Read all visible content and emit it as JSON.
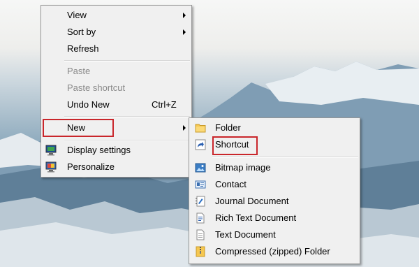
{
  "context_menu": {
    "items": [
      {
        "label": "View",
        "submenu": true
      },
      {
        "label": "Sort by",
        "submenu": true
      },
      {
        "label": "Refresh"
      },
      {
        "label": "Paste",
        "disabled": true
      },
      {
        "label": "Paste shortcut",
        "disabled": true
      },
      {
        "label": "Undo New",
        "shortcut": "Ctrl+Z"
      },
      {
        "label": "New",
        "submenu": true,
        "highlighted": true
      },
      {
        "label": "Display settings",
        "icon": "display-settings-icon"
      },
      {
        "label": "Personalize",
        "icon": "personalize-icon"
      }
    ]
  },
  "new_submenu": {
    "items": [
      {
        "label": "Folder",
        "icon": "folder-icon"
      },
      {
        "label": "Shortcut",
        "icon": "shortcut-icon",
        "highlighted": true
      },
      {
        "label": "Bitmap image",
        "icon": "bitmap-image-icon"
      },
      {
        "label": "Contact",
        "icon": "contact-icon"
      },
      {
        "label": "Journal Document",
        "icon": "journal-document-icon"
      },
      {
        "label": "Rich Text Document",
        "icon": "rich-text-document-icon"
      },
      {
        "label": "Text Document",
        "icon": "text-document-icon"
      },
      {
        "label": "Compressed (zipped) Folder",
        "icon": "zip-folder-icon"
      }
    ]
  },
  "highlight_color": "#c9262b"
}
